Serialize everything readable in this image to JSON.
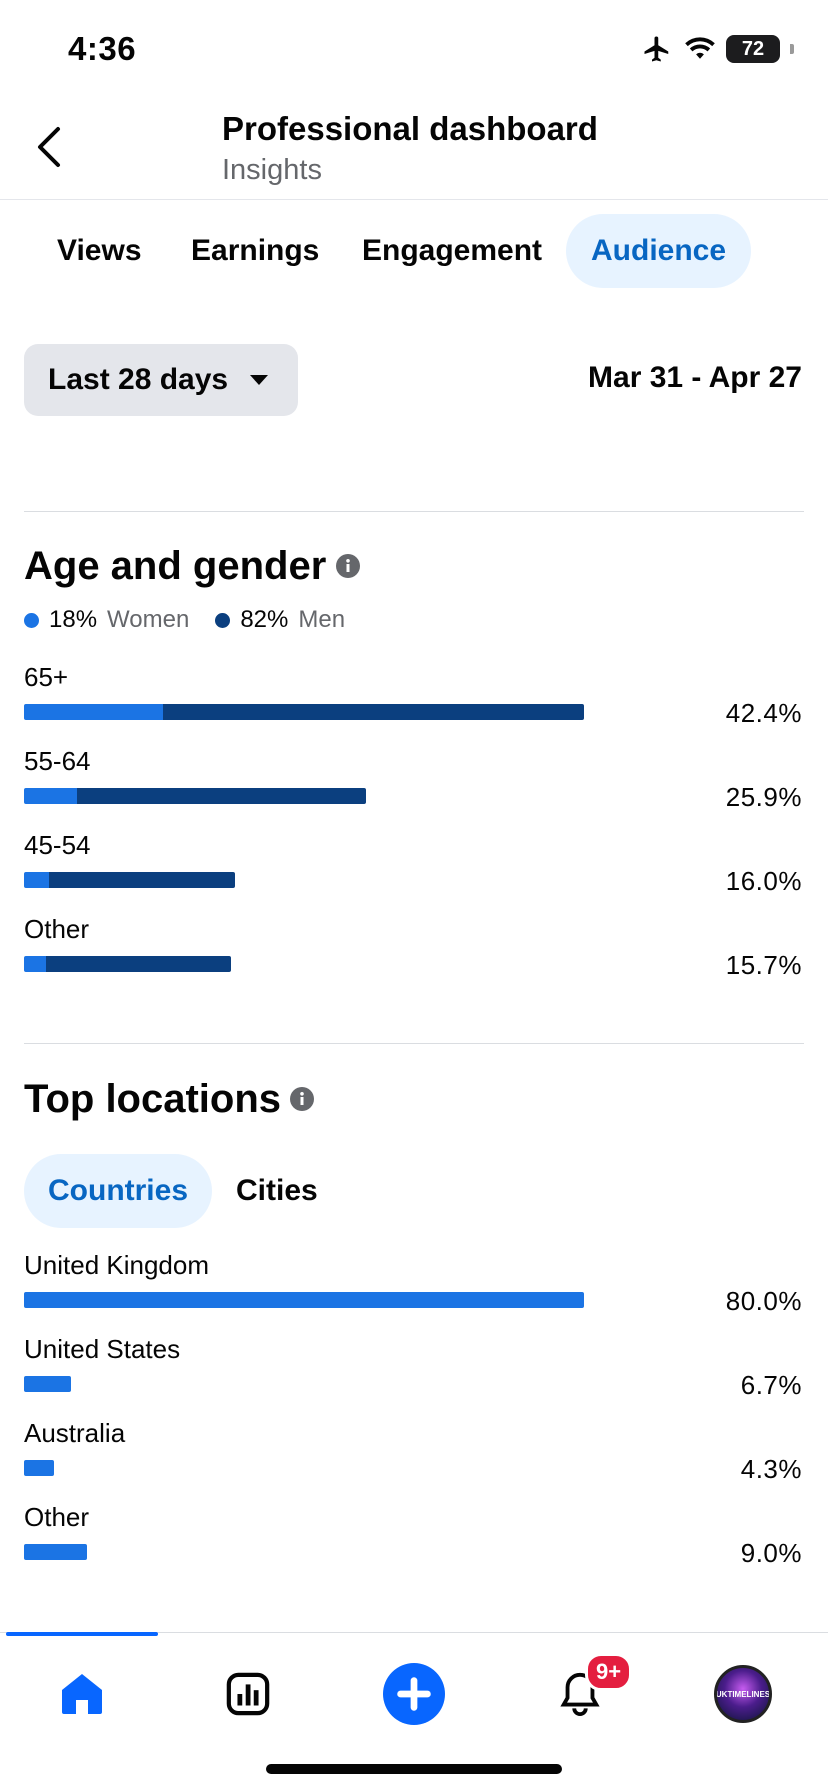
{
  "status": {
    "time": "4:36",
    "battery": "72"
  },
  "header": {
    "title": "Professional dashboard",
    "subtitle": "Insights"
  },
  "tabs": [
    {
      "label": "Views",
      "active": false
    },
    {
      "label": "Earnings",
      "active": false
    },
    {
      "label": "Engagement",
      "active": false
    },
    {
      "label": "Audience",
      "active": true
    }
  ],
  "range": {
    "label": "Last 28 days",
    "dates": "Mar 31 - Apr 27"
  },
  "age_gender": {
    "title": "Age and gender",
    "women": {
      "value": "18%",
      "label": "Women"
    },
    "men": {
      "value": "82%",
      "label": "Men"
    },
    "rows": [
      {
        "label": "65+",
        "pct": "42.4%",
        "women": 0.105,
        "men": 0.319
      },
      {
        "label": "55-64",
        "pct": "25.9%",
        "women": 0.04,
        "men": 0.219
      },
      {
        "label": "45-54",
        "pct": "16.0%",
        "women": 0.019,
        "men": 0.141
      },
      {
        "label": "Other",
        "pct": "15.7%",
        "women": 0.017,
        "men": 0.14
      }
    ]
  },
  "locations": {
    "title": "Top locations",
    "tabs": [
      {
        "label": "Countries",
        "active": true
      },
      {
        "label": "Cities",
        "active": false
      }
    ],
    "rows": [
      {
        "label": "United Kingdom",
        "pct": "80.0%",
        "value": 0.8
      },
      {
        "label": "United States",
        "pct": "6.7%",
        "value": 0.067
      },
      {
        "label": "Australia",
        "pct": "4.3%",
        "value": 0.043
      },
      {
        "label": "Other",
        "pct": "9.0%",
        "value": 0.09
      }
    ]
  },
  "nav": {
    "items": [
      "home-icon",
      "insights-icon",
      "create-icon",
      "notifications-icon",
      "profile-avatar"
    ],
    "notification_badge": "9+",
    "avatar_text": "UKTIMELINES"
  },
  "colors": {
    "women": "#1b74e4",
    "men": "#0b3f7f",
    "accent": "#0866c2"
  }
}
